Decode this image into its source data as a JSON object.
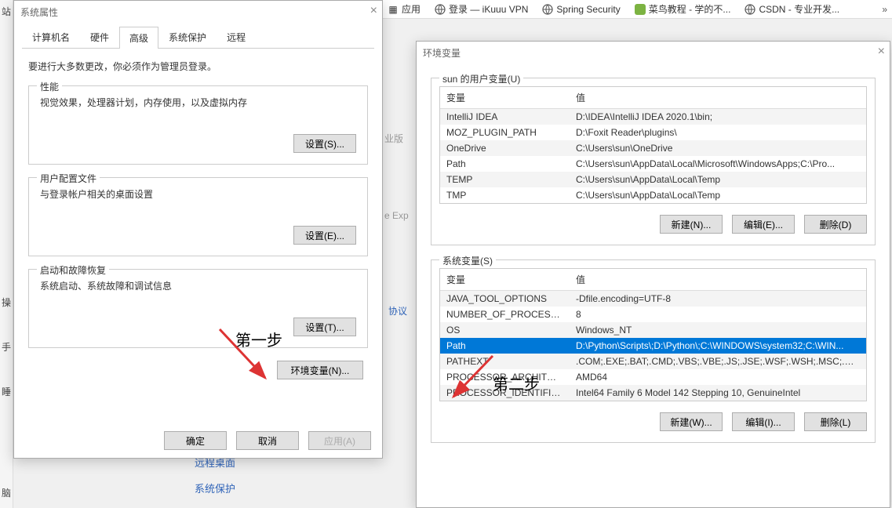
{
  "bookmarks": {
    "apps": "应用",
    "items": [
      {
        "label": "登录 — iKuuu VPN",
        "icon": "globe"
      },
      {
        "label": "Spring Security",
        "icon": "globe"
      },
      {
        "label": "菜鸟教程 - 学的不...",
        "icon": "green"
      },
      {
        "label": "CSDN - 专业开发...",
        "icon": "globe"
      }
    ]
  },
  "sidebar_chars": [
    "站",
    "操",
    "手",
    "睡",
    "脑"
  ],
  "bg_fragments": {
    "ye": "业版",
    "exp": "e Exp",
    "proto": "协议"
  },
  "bg_links": [
    "远程桌面",
    "系统保护"
  ],
  "sysprops": {
    "title": "系统属性",
    "tabs": [
      "计算机名",
      "硬件",
      "高级",
      "系统保护",
      "远程"
    ],
    "notice": "要进行大多数更改，你必须作为管理员登录。",
    "perf": {
      "legend": "性能",
      "desc": "视觉效果，处理器计划，内存使用，以及虚拟内存",
      "btn": "设置(S)..."
    },
    "profile": {
      "legend": "用户配置文件",
      "desc": "与登录帐户相关的桌面设置",
      "btn": "设置(E)..."
    },
    "startup": {
      "legend": "启动和故障恢复",
      "desc": "系统启动、系统故障和调试信息",
      "btn": "设置(T)..."
    },
    "env_btn": "环境变量(N)...",
    "ok": "确定",
    "cancel": "取消",
    "apply": "应用(A)"
  },
  "envvars": {
    "title": "环境变量",
    "user_legend": "sun 的用户变量(U)",
    "sys_legend": "系统变量(S)",
    "col_var": "变量",
    "col_val": "值",
    "user_rows": [
      {
        "name": "IntelliJ IDEA",
        "value": "D:\\IDEA\\IntelliJ IDEA 2020.1\\bin;"
      },
      {
        "name": "MOZ_PLUGIN_PATH",
        "value": "D:\\Foxit Reader\\plugins\\"
      },
      {
        "name": "OneDrive",
        "value": "C:\\Users\\sun\\OneDrive"
      },
      {
        "name": "Path",
        "value": "C:\\Users\\sun\\AppData\\Local\\Microsoft\\WindowsApps;C:\\Pro..."
      },
      {
        "name": "TEMP",
        "value": "C:\\Users\\sun\\AppData\\Local\\Temp"
      },
      {
        "name": "TMP",
        "value": "C:\\Users\\sun\\AppData\\Local\\Temp"
      }
    ],
    "sys_rows": [
      {
        "name": "JAVA_TOOL_OPTIONS",
        "value": "-Dfile.encoding=UTF-8"
      },
      {
        "name": "NUMBER_OF_PROCESSORS",
        "value": "8"
      },
      {
        "name": "OS",
        "value": "Windows_NT"
      },
      {
        "name": "Path",
        "value": "D:\\Python\\Scripts\\;D:\\Python\\;C:\\WINDOWS\\system32;C:\\WIN...",
        "selected": true
      },
      {
        "name": "PATHEXT",
        "value": ".COM;.EXE;.BAT;.CMD;.VBS;.VBE;.JS;.JSE;.WSF;.WSH;.MSC;.PY;.P..."
      },
      {
        "name": "PROCESSOR_ARCHITECT...",
        "value": "AMD64"
      },
      {
        "name": "PROCESSOR_IDENTIFIER",
        "value": "Intel64 Family 6 Model 142 Stepping 10, GenuineIntel"
      }
    ],
    "new_u": "新建(N)...",
    "edit_u": "编辑(E)...",
    "del_u": "删除(D)",
    "new_s": "新建(W)...",
    "edit_s": "编辑(I)...",
    "del_s": "删除(L)"
  },
  "annotations": {
    "step1": "第一步",
    "step2": "第二步"
  }
}
